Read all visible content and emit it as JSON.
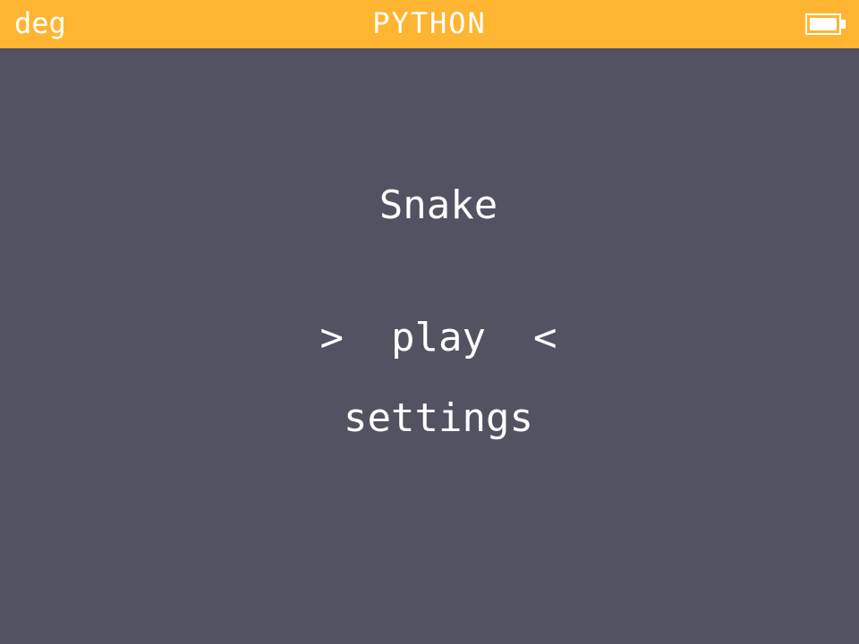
{
  "statusbar": {
    "angle_unit": "deg",
    "app_name": "PYTHON",
    "battery_icon": "battery-full-icon",
    "color": "#ffb531"
  },
  "screen": {
    "background": "#525263",
    "game_title": "Snake",
    "menu": {
      "selected_item": ">  play  <",
      "items": [
        "play",
        "settings"
      ],
      "settings_label": "settings"
    }
  }
}
